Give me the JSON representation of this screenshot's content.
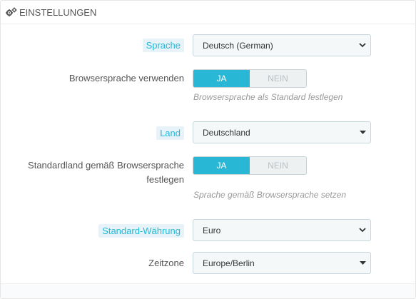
{
  "panel": {
    "title": "EINSTELLUNGEN"
  },
  "fields": {
    "language": {
      "label": "Sprache",
      "value": "Deutsch (German)"
    },
    "browser_language": {
      "label": "Browsersprache verwenden",
      "yes": "JA",
      "no": "NEIN",
      "selected": "JA",
      "help": "Browsersprache als Standard festlegen"
    },
    "country": {
      "label": "Land",
      "value": "Deutschland"
    },
    "default_country": {
      "label_line1": "Standardland gemäß Browsersprache",
      "label_line2": "festlegen",
      "yes": "JA",
      "no": "NEIN",
      "selected": "JA",
      "help": "Sprache gemäß Browsersprache setzen"
    },
    "currency": {
      "label": "Standard-Währung",
      "value": "Euro"
    },
    "timezone": {
      "label": "Zeitzone",
      "value": "Europe/Berlin"
    }
  },
  "colors": {
    "accent": "#25b9d7",
    "toggle_on": "#28b7d5",
    "label_highlight_bg": "#e7f3f8"
  },
  "icons": {
    "heading": "gears-icon",
    "select": "chevron-down-icon",
    "country_select": "caret-down-icon"
  }
}
